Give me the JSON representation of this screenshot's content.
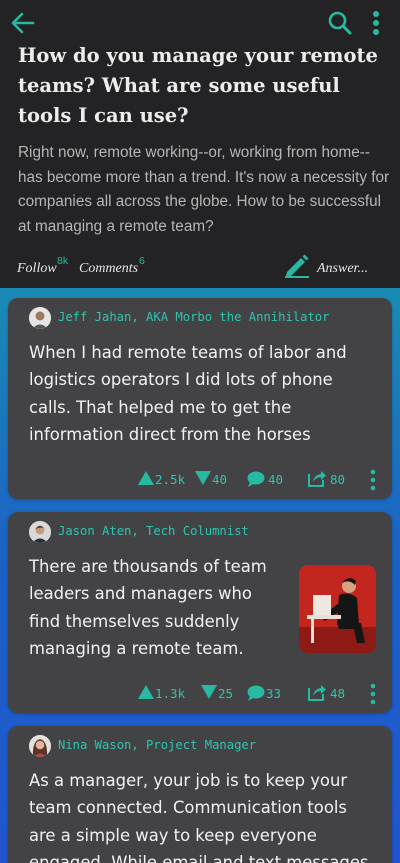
{
  "question": {
    "title": "How do you manage your remote teams? What are some useful tools I can use?",
    "body": "Right now, remote working--or, working from home--has become more than a trend. It's now a necessity for companies all across the globe. How to be successful at managing a remote team?",
    "follow_label": "Follow",
    "follow_count": "8k",
    "comments_label": "Comments",
    "comments_count": "6",
    "answer_label": "Answer..."
  },
  "icons": {
    "back": "arrow-left-icon",
    "search": "search-icon",
    "more": "more-vertical-icon",
    "answer": "pencil-icon",
    "upvote": "triangle-up-icon",
    "downvote": "triangle-down-icon",
    "comment": "speech-bubble-icon",
    "share": "share-icon"
  },
  "colors": {
    "accent": "#28b9a3",
    "header_bg": "#232325",
    "card_bg": "#434346"
  },
  "answers": [
    {
      "author": "Jeff Jahan, AKA Morbo the Annihilator",
      "text_lines": [
        "When I had remote teams of labor and",
        "logistics operators I did lots of phone",
        "calls. That helped me to get the",
        "information direct from the horses"
      ],
      "upvotes": "2.5k",
      "downvotes": "40",
      "comments": "40",
      "shares": "80"
    },
    {
      "author": "Jason Aten, Tech Columnist",
      "text_lines": [
        "There are thousands of team",
        "leaders and managers who",
        "find themselves suddenly",
        "managing a remote team."
      ],
      "upvotes": "1.3k",
      "downvotes": "25",
      "comments": "33",
      "shares": "48"
    },
    {
      "author": "Nina Wason, Project Manager",
      "text_lines": [
        "As a manager, your job is to keep your",
        "team connected. Communication tools",
        "are a simple way to keep everyone",
        "engaged. While email and text messages"
      ]
    }
  ]
}
